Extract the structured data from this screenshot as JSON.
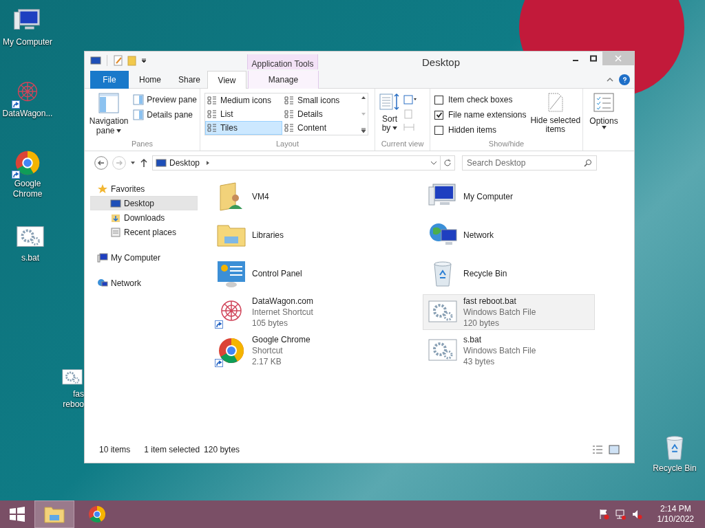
{
  "desktop_icons": [
    {
      "kind": "computer",
      "lines": [
        "My Computer"
      ],
      "shortcut": false
    },
    {
      "kind": "web",
      "lines": [
        "DataWagon..."
      ],
      "shortcut": true
    },
    {
      "kind": "chrome",
      "lines": [
        "Google",
        "Chrome"
      ],
      "shortcut": true
    },
    {
      "kind": "batch",
      "lines": [
        "s.bat"
      ],
      "shortcut": false
    },
    {
      "kind": "batch",
      "lines": [
        "fas",
        "reboo"
      ],
      "shortcut": false
    },
    {
      "kind": "recycle",
      "lines": [
        "Recycle Bin"
      ],
      "shortcut": false
    }
  ],
  "window": {
    "title": "Desktop",
    "tabs": [
      {
        "label": "File",
        "kind": "file",
        "selected": false
      },
      {
        "label": "Home",
        "kind": "tab",
        "selected": false
      },
      {
        "label": "Share",
        "kind": "tab",
        "selected": false
      },
      {
        "label": "View",
        "kind": "tab",
        "selected": true
      }
    ],
    "contextual": {
      "group": "Application Tools",
      "tab": "Manage"
    },
    "ribbon": {
      "panes": {
        "caption": "Panes",
        "navigation": [
          "Navigation",
          "pane"
        ],
        "items": [
          "Preview pane",
          "Details pane"
        ]
      },
      "layout": {
        "caption": "Layout",
        "options": [
          {
            "label": "Medium icons",
            "selected": false
          },
          {
            "label": "Small icons",
            "selected": false
          },
          {
            "label": "List",
            "selected": false
          },
          {
            "label": "Details",
            "selected": false
          },
          {
            "label": "Tiles",
            "selected": true
          },
          {
            "label": "Content",
            "selected": false
          }
        ]
      },
      "current_view": {
        "caption": "Current view",
        "sort": [
          "Sort",
          "by"
        ]
      },
      "show_hide": {
        "caption": "Show/hide",
        "checkboxes": [
          {
            "label": "Item check boxes",
            "checked": false
          },
          {
            "label": "File name extensions",
            "checked": true
          },
          {
            "label": "Hidden items",
            "checked": false
          }
        ],
        "hide_selected": [
          "Hide selected",
          "items"
        ]
      },
      "options": {
        "label": "Options"
      }
    },
    "address": {
      "location": "Desktop",
      "search_placeholder": "Search Desktop"
    },
    "nav": [
      {
        "label": "Favorites",
        "kind": "star",
        "selected": false,
        "children": [
          {
            "label": "Desktop",
            "kind": "desktop",
            "selected": true
          },
          {
            "label": "Downloads",
            "kind": "downloads",
            "selected": false
          },
          {
            "label": "Recent places",
            "kind": "recent",
            "selected": false
          }
        ]
      },
      {
        "label": "My Computer",
        "kind": "computer",
        "selected": false
      },
      {
        "label": "Network",
        "kind": "network",
        "selected": false
      }
    ],
    "items": [
      {
        "kind": "user",
        "lines": [
          "VM4"
        ],
        "selected": false,
        "shortcut": false
      },
      {
        "kind": "computer",
        "lines": [
          "My Computer"
        ],
        "selected": false,
        "shortcut": false
      },
      {
        "kind": "libraries",
        "lines": [
          "Libraries"
        ],
        "selected": false,
        "shortcut": false
      },
      {
        "kind": "network",
        "lines": [
          "Network"
        ],
        "selected": false,
        "shortcut": false
      },
      {
        "kind": "control",
        "lines": [
          "Control Panel"
        ],
        "selected": false,
        "shortcut": false
      },
      {
        "kind": "recycle",
        "lines": [
          "Recycle Bin"
        ],
        "selected": false,
        "shortcut": false
      },
      {
        "kind": "web",
        "lines": [
          "DataWagon.com",
          "Internet Shortcut",
          "105 bytes"
        ],
        "selected": false,
        "shortcut": true
      },
      {
        "kind": "batch",
        "lines": [
          "fast reboot.bat",
          "Windows Batch File",
          "120 bytes"
        ],
        "selected": true,
        "shortcut": false
      },
      {
        "kind": "chrome",
        "lines": [
          "Google Chrome",
          "Shortcut",
          "2.17 KB"
        ],
        "selected": false,
        "shortcut": true
      },
      {
        "kind": "batch",
        "lines": [
          "s.bat",
          "Windows Batch File",
          "43 bytes"
        ],
        "selected": false,
        "shortcut": false
      }
    ],
    "status": {
      "count": "10 items",
      "selection": "1 item selected",
      "size": "120 bytes"
    }
  },
  "taskbar": {
    "apps": [
      {
        "kind": "explorer",
        "selected": true
      },
      {
        "kind": "chrome",
        "selected": false
      }
    ],
    "time": "2:14 PM",
    "date": "1/10/2022"
  }
}
